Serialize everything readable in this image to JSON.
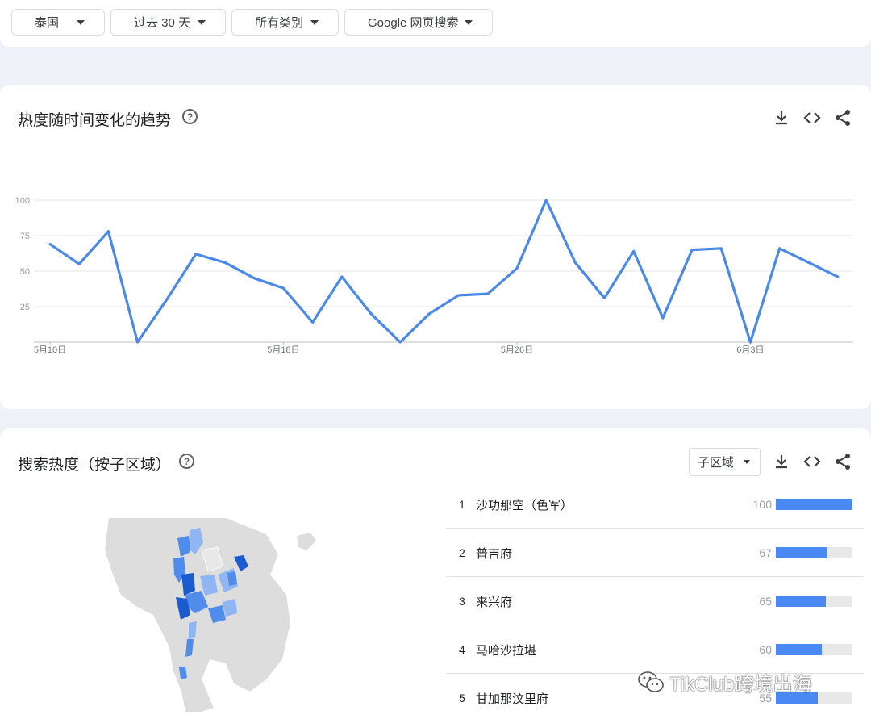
{
  "filters": {
    "region": "泰国",
    "time": "过去 30 天",
    "category": "所有类别",
    "search_type": "Google 网页搜索"
  },
  "trend_card": {
    "title": "热度随时间变化的趋势",
    "help": "?"
  },
  "region_card": {
    "title": "搜索热度（按子区域）",
    "help": "?",
    "resolution_select": "子区域"
  },
  "chart_data": {
    "type": "line",
    "title": "",
    "xlabel": "",
    "ylabel": "",
    "ylim": [
      0,
      100
    ],
    "y_ticks": [
      25,
      50,
      75,
      100
    ],
    "x_tick_labels": [
      {
        "label": "5月10日",
        "day": 0
      },
      {
        "label": "5月18日",
        "day": 8
      },
      {
        "label": "5月26日",
        "day": 16
      },
      {
        "label": "6月3日",
        "day": 24
      }
    ],
    "x": [
      "5月10日",
      "5月11日",
      "5月12日",
      "5月13日",
      "5月14日",
      "5月15日",
      "5月16日",
      "5月17日",
      "5月18日",
      "5月19日",
      "5月20日",
      "5月21日",
      "5月22日",
      "5月23日",
      "5月24日",
      "5月25日",
      "5月26日",
      "5月27日",
      "5月28日",
      "5月29日",
      "5月30日",
      "5月31日",
      "6月1日",
      "6月2日",
      "6月3日",
      "6月4日",
      "6月5日",
      "6月6日"
    ],
    "series": [
      {
        "color": "#4a89e8",
        "values": [
          69,
          55,
          78,
          0,
          30,
          62,
          56,
          45,
          38,
          14,
          46,
          20,
          0,
          20,
          33,
          34,
          52,
          100,
          56,
          31,
          64,
          17,
          65,
          66,
          0,
          66,
          56,
          46
        ]
      }
    ],
    "grid": true
  },
  "rankings": [
    {
      "rank": "1",
      "name": "沙功那空（色军）",
      "value": 100
    },
    {
      "rank": "2",
      "name": "普吉府",
      "value": 67
    },
    {
      "rank": "3",
      "name": "来兴府",
      "value": 65
    },
    {
      "rank": "4",
      "name": "马哈沙拉堪",
      "value": 60
    },
    {
      "rank": "5",
      "name": "甘加那汶里府",
      "value": 55
    }
  ],
  "colors": {
    "accent": "#4a89e8",
    "bar": "#4a89f3",
    "map_land": "#dddddd",
    "map_dark": "#1a5bd0",
    "map_mid": "#4f8cec",
    "map_light": "#8fb5f3"
  },
  "watermark": {
    "text": "TikClub跨境出海",
    "icon": "wechat-icon"
  }
}
